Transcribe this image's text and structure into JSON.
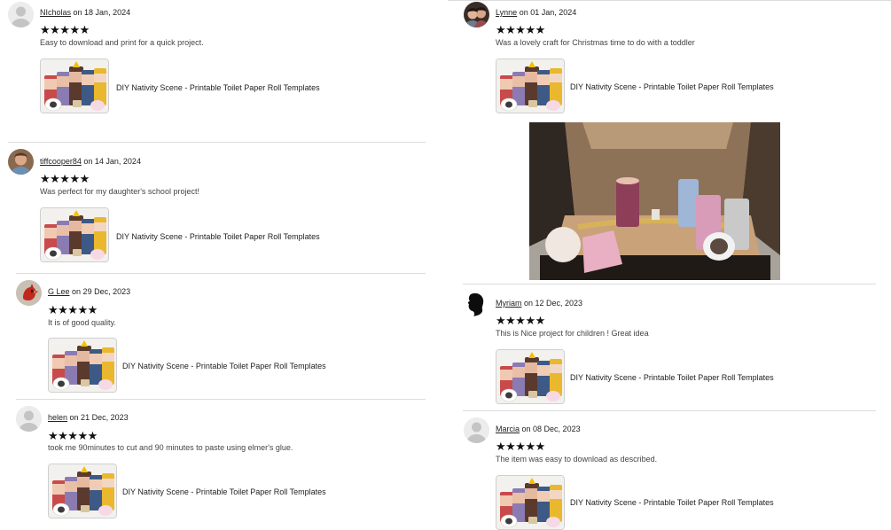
{
  "star_glyphs": "★★★★★",
  "product_name": "DIY Nativity Scene - Printable Toilet Paper Roll Templates",
  "colors": {
    "divider": "#dcdcdc",
    "star": "#111111",
    "link_text": "#222222"
  },
  "reviews": [
    {
      "user": "NIcholas",
      "date_text": "on 18 Jan, 2024",
      "rating": 5,
      "text": "Easy to download and print for a quick project.",
      "avatar_icon": "default-avatar-icon"
    },
    {
      "user": "tiffcooper84",
      "date_text": "on 14 Jan, 2024",
      "rating": 5,
      "text": "Was perfect for my daughter's school project!",
      "avatar_icon": "photo-avatar-icon"
    },
    {
      "user": "G Lee",
      "date_text": "on 29 Dec, 2023",
      "rating": 5,
      "text": "It is of good quality.",
      "avatar_icon": "cardinal-bird-avatar-icon"
    },
    {
      "user": "helen",
      "date_text": "on 21 Dec, 2023",
      "rating": 5,
      "text": "took me 90minutes to cut and 90 minutes to paste using elmer's glue.",
      "avatar_icon": "default-avatar-icon"
    },
    {
      "user": "Lynne",
      "date_text": "on 01 Jan, 2024",
      "rating": 5,
      "text": "Was a lovely craft for Christmas time to do with a toddler",
      "avatar_icon": "photo-avatar-icon",
      "has_photo": true
    },
    {
      "user": "Myriam",
      "date_text": "on 12 Dec, 2023",
      "rating": 5,
      "text": "This is Nice project for children ! Great idea",
      "avatar_icon": "silhouette-avatar-icon"
    },
    {
      "user": "Marcia",
      "date_text": "on 08 Dec, 2023",
      "rating": 5,
      "text": "The item was easy to download as described.",
      "avatar_icon": "default-avatar-icon"
    }
  ]
}
